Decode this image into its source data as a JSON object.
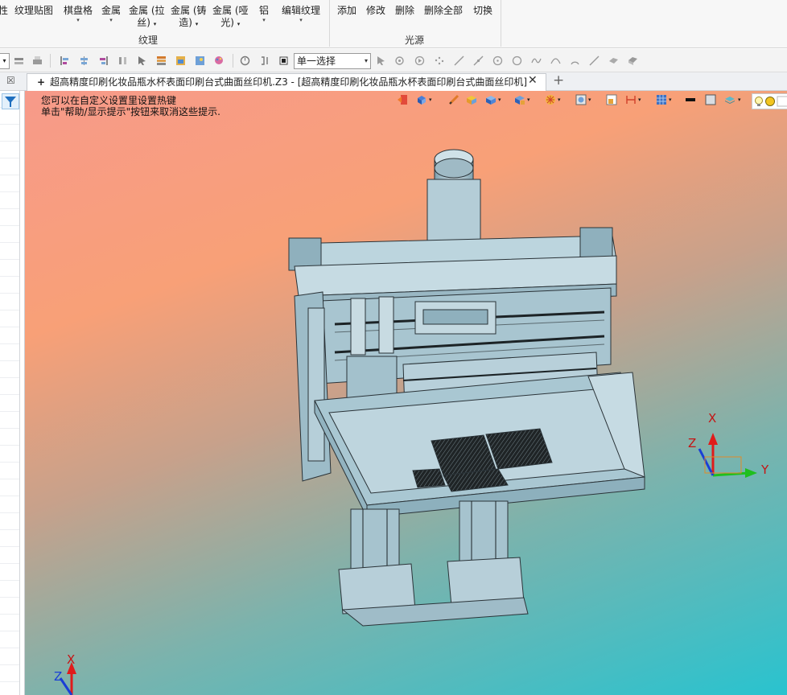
{
  "ribbon": {
    "items": [
      {
        "label": "性",
        "dropdown": false
      },
      {
        "label": "纹理贴图",
        "dropdown": false
      },
      {
        "label": "棋盘格",
        "dropdown": true
      },
      {
        "label": "金属",
        "dropdown": true
      },
      {
        "label": "金属 (拉",
        "label2": "丝)",
        "dropdown": true
      },
      {
        "label": "金属 (铸",
        "label2": "造)",
        "dropdown": true
      },
      {
        "label": "金属 (哑",
        "label2": "光)",
        "dropdown": true
      },
      {
        "label": "铝",
        "dropdown": true
      },
      {
        "label": "编辑纹理",
        "dropdown": true
      },
      {
        "label": "添加",
        "dropdown": false
      },
      {
        "label": "修改",
        "dropdown": false
      },
      {
        "label": "删除",
        "dropdown": false
      },
      {
        "label": "删除全部",
        "dropdown": false
      },
      {
        "label": "切换",
        "dropdown": false
      }
    ],
    "groups": {
      "texture": "纹理",
      "light": "光源"
    },
    "dropdown_glyph": "▾"
  },
  "toolbar": {
    "select_mode": "单一选择",
    "dropdown_glyph": "▾"
  },
  "tabs": {
    "left_close": "☒",
    "active_tab": "超高精度印刷化妆品瓶水杯表面印刷台式曲面丝印机.Z3 - [超高精度印刷化妆品瓶水杯表面印刷台式曲面丝印机]",
    "tab_plus": "+",
    "close_glyph": "✕",
    "add_glyph": "+"
  },
  "viewport": {
    "hint_line1": "您可以在自定义设置里设置热键",
    "hint_line2": "单击\"帮助/显示提示\"按钮来取消这些提示.",
    "right_button_label": "",
    "axis": {
      "x": "X",
      "y": "Y",
      "z": "Z"
    },
    "colors": {
      "x_axis": "#e01b1b",
      "y_axis": "#1fbf1f",
      "z_axis": "#1a3fd6",
      "model_fill": "#a9c7d2",
      "model_line": "#2a3338"
    }
  }
}
